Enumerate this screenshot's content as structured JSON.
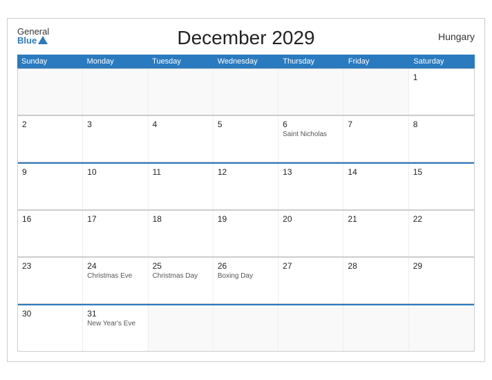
{
  "header": {
    "title": "December 2029",
    "country": "Hungary",
    "logo_general": "General",
    "logo_blue": "Blue"
  },
  "dayHeaders": [
    "Sunday",
    "Monday",
    "Tuesday",
    "Wednesday",
    "Thursday",
    "Friday",
    "Saturday"
  ],
  "weeks": [
    {
      "highlighted": false,
      "days": [
        {
          "number": "",
          "event": "",
          "empty": true
        },
        {
          "number": "",
          "event": "",
          "empty": true
        },
        {
          "number": "",
          "event": "",
          "empty": true
        },
        {
          "number": "",
          "event": "",
          "empty": true
        },
        {
          "number": "",
          "event": "",
          "empty": true
        },
        {
          "number": "",
          "event": "",
          "empty": true
        },
        {
          "number": "1",
          "event": "",
          "empty": false
        }
      ]
    },
    {
      "highlighted": false,
      "days": [
        {
          "number": "2",
          "event": "",
          "empty": false
        },
        {
          "number": "3",
          "event": "",
          "empty": false
        },
        {
          "number": "4",
          "event": "",
          "empty": false
        },
        {
          "number": "5",
          "event": "",
          "empty": false
        },
        {
          "number": "6",
          "event": "Saint Nicholas",
          "empty": false
        },
        {
          "number": "7",
          "event": "",
          "empty": false
        },
        {
          "number": "8",
          "event": "",
          "empty": false
        }
      ]
    },
    {
      "highlighted": true,
      "days": [
        {
          "number": "9",
          "event": "",
          "empty": false
        },
        {
          "number": "10",
          "event": "",
          "empty": false
        },
        {
          "number": "11",
          "event": "",
          "empty": false
        },
        {
          "number": "12",
          "event": "",
          "empty": false
        },
        {
          "number": "13",
          "event": "",
          "empty": false
        },
        {
          "number": "14",
          "event": "",
          "empty": false
        },
        {
          "number": "15",
          "event": "",
          "empty": false
        }
      ]
    },
    {
      "highlighted": false,
      "days": [
        {
          "number": "16",
          "event": "",
          "empty": false
        },
        {
          "number": "17",
          "event": "",
          "empty": false
        },
        {
          "number": "18",
          "event": "",
          "empty": false
        },
        {
          "number": "19",
          "event": "",
          "empty": false
        },
        {
          "number": "20",
          "event": "",
          "empty": false
        },
        {
          "number": "21",
          "event": "",
          "empty": false
        },
        {
          "number": "22",
          "event": "",
          "empty": false
        }
      ]
    },
    {
      "highlighted": false,
      "days": [
        {
          "number": "23",
          "event": "",
          "empty": false
        },
        {
          "number": "24",
          "event": "Christmas Eve",
          "empty": false
        },
        {
          "number": "25",
          "event": "Christmas Day",
          "empty": false
        },
        {
          "number": "26",
          "event": "Boxing Day",
          "empty": false
        },
        {
          "number": "27",
          "event": "",
          "empty": false
        },
        {
          "number": "28",
          "event": "",
          "empty": false
        },
        {
          "number": "29",
          "event": "",
          "empty": false
        }
      ]
    },
    {
      "highlighted": true,
      "days": [
        {
          "number": "30",
          "event": "",
          "empty": false
        },
        {
          "number": "31",
          "event": "New Year's Eve",
          "empty": false
        },
        {
          "number": "",
          "event": "",
          "empty": true
        },
        {
          "number": "",
          "event": "",
          "empty": true
        },
        {
          "number": "",
          "event": "",
          "empty": true
        },
        {
          "number": "",
          "event": "",
          "empty": true
        },
        {
          "number": "",
          "event": "",
          "empty": true
        }
      ]
    }
  ]
}
